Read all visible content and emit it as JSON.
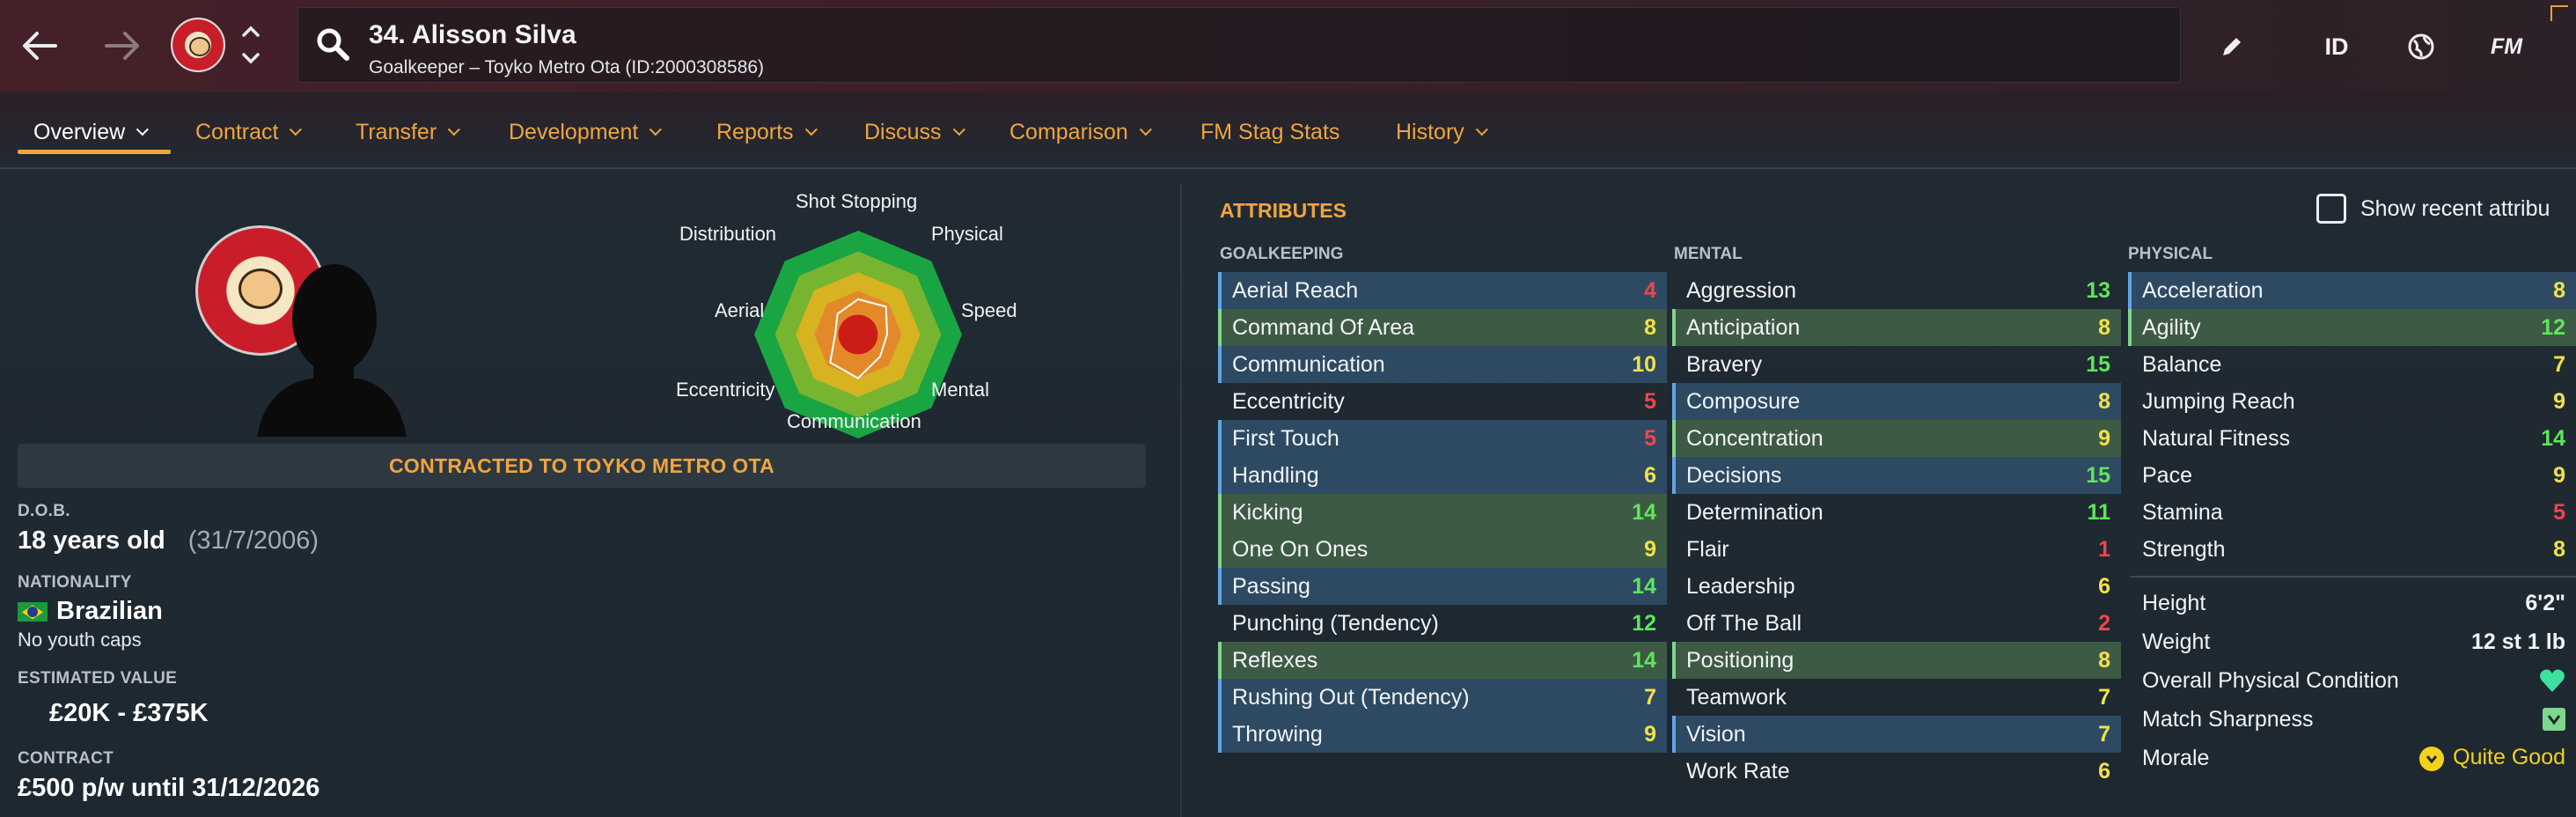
{
  "header": {
    "player_title": "34. Alisson Silva",
    "player_subtitle": "Goalkeeper – Toyko Metro Ota (ID:2000308586)",
    "tools": {
      "id_label": "ID",
      "fm_label": "FM"
    }
  },
  "tabs": [
    {
      "label": "Overview",
      "active": true,
      "dropdown": true
    },
    {
      "label": "Contract",
      "dropdown": true
    },
    {
      "label": "Transfer",
      "dropdown": true
    },
    {
      "label": "Development",
      "dropdown": true
    },
    {
      "label": "Reports",
      "dropdown": true
    },
    {
      "label": "Discuss",
      "dropdown": true
    },
    {
      "label": "Comparison",
      "dropdown": true
    },
    {
      "label": "FM Stag Stats",
      "dropdown": false
    },
    {
      "label": "History",
      "dropdown": true
    }
  ],
  "profile": {
    "contract_banner": "CONTRACTED TO TOYKO METRO OTA",
    "dob_label": "D.O.B.",
    "age": "18 years old",
    "dob": "(31/7/2006)",
    "nationality_label": "NATIONALITY",
    "nationality": "Brazilian",
    "youth_caps": "No youth caps",
    "value_label": "ESTIMATED VALUE",
    "value": "£20K - £375K",
    "contract_label": "CONTRACT",
    "contract": "£500 p/w until 31/12/2026"
  },
  "radar": {
    "labels": [
      "Shot Stopping",
      "Physical",
      "Speed",
      "Mental",
      "Communication",
      "Eccentricity",
      "Aerial",
      "Distribution"
    ],
    "player_values": [
      0.34,
      0.38,
      0.28,
      0.3,
      0.42,
      0.38,
      0.22,
      0.28
    ]
  },
  "attributes": {
    "title": "ATTRIBUTES",
    "show_recent_label": "Show recent attribu",
    "goalkeeping": {
      "heading": "GOALKEEPING",
      "rows": [
        {
          "name": "Aerial Reach",
          "value": "4",
          "highlight": "blue"
        },
        {
          "name": "Command Of Area",
          "value": "8",
          "highlight": "green"
        },
        {
          "name": "Communication",
          "value": "10",
          "highlight": "blue"
        },
        {
          "name": "Eccentricity",
          "value": "5",
          "highlight": "plain"
        },
        {
          "name": "First Touch",
          "value": "5",
          "highlight": "blue"
        },
        {
          "name": "Handling",
          "value": "6",
          "highlight": "blue"
        },
        {
          "name": "Kicking",
          "value": "14",
          "highlight": "green"
        },
        {
          "name": "One On Ones",
          "value": "9",
          "highlight": "green"
        },
        {
          "name": "Passing",
          "value": "14",
          "highlight": "blue"
        },
        {
          "name": "Punching (Tendency)",
          "value": "12",
          "highlight": "plain"
        },
        {
          "name": "Reflexes",
          "value": "14",
          "highlight": "green"
        },
        {
          "name": "Rushing Out (Tendency)",
          "value": "7",
          "highlight": "blue"
        },
        {
          "name": "Throwing",
          "value": "9",
          "highlight": "blue"
        }
      ]
    },
    "mental": {
      "heading": "MENTAL",
      "rows": [
        {
          "name": "Aggression",
          "value": "13",
          "highlight": "plain"
        },
        {
          "name": "Anticipation",
          "value": "8",
          "highlight": "green"
        },
        {
          "name": "Bravery",
          "value": "15",
          "highlight": "plain"
        },
        {
          "name": "Composure",
          "value": "8",
          "highlight": "blue"
        },
        {
          "name": "Concentration",
          "value": "9",
          "highlight": "green"
        },
        {
          "name": "Decisions",
          "value": "15",
          "highlight": "blue"
        },
        {
          "name": "Determination",
          "value": "11",
          "highlight": "plain"
        },
        {
          "name": "Flair",
          "value": "1",
          "highlight": "plain"
        },
        {
          "name": "Leadership",
          "value": "6",
          "highlight": "plain"
        },
        {
          "name": "Off The Ball",
          "value": "2",
          "highlight": "plain"
        },
        {
          "name": "Positioning",
          "value": "8",
          "highlight": "green"
        },
        {
          "name": "Teamwork",
          "value": "7",
          "highlight": "plain"
        },
        {
          "name": "Vision",
          "value": "7",
          "highlight": "blue"
        },
        {
          "name": "Work Rate",
          "value": "6",
          "highlight": "plain"
        }
      ]
    },
    "physical": {
      "heading": "PHYSICAL",
      "rows": [
        {
          "name": "Acceleration",
          "value": "8",
          "highlight": "blue"
        },
        {
          "name": "Agility",
          "value": "12",
          "highlight": "green"
        },
        {
          "name": "Balance",
          "value": "7",
          "highlight": "plain"
        },
        {
          "name": "Jumping Reach",
          "value": "9",
          "highlight": "plain"
        },
        {
          "name": "Natural Fitness",
          "value": "14",
          "highlight": "plain"
        },
        {
          "name": "Pace",
          "value": "9",
          "highlight": "plain"
        },
        {
          "name": "Stamina",
          "value": "5",
          "highlight": "plain"
        },
        {
          "name": "Strength",
          "value": "8",
          "highlight": "plain"
        }
      ],
      "extras": {
        "height_label": "Height",
        "height": "6'2\"",
        "weight_label": "Weight",
        "weight": "12 st 1 lb",
        "condition_label": "Overall Physical Condition",
        "sharpness_label": "Match Sharpness",
        "morale_label": "Morale",
        "morale": "Quite Good"
      }
    }
  },
  "colors": {
    "accent": "#f0a53d",
    "value_low": "#f0454f",
    "value_mid": "#f2e14a",
    "value_high": "#5ee65a",
    "row_blue": "#2e4a63",
    "row_green": "#3d5a45"
  }
}
